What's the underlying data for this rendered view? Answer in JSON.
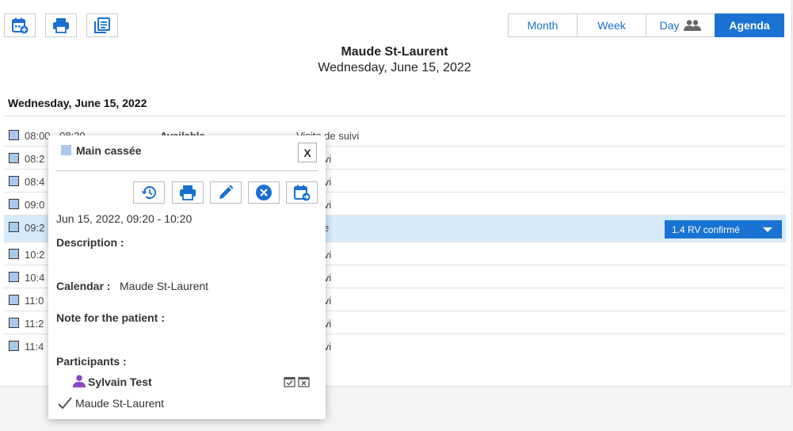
{
  "toolbar": {
    "new_icon": "calendar-plus-icon",
    "print_icon": "printer-icon",
    "list_icon": "list-icon"
  },
  "views": [
    {
      "label": "Month",
      "active": false
    },
    {
      "label": "Week",
      "active": false
    },
    {
      "label": "Day",
      "active": false,
      "icon": "people-icon"
    },
    {
      "label": "Agenda",
      "active": true
    }
  ],
  "header": {
    "name": "Maude St-Laurent",
    "date": "Wednesday, June 15, 2022"
  },
  "agenda": {
    "day_label": "Wednesday, June 15, 2022",
    "rows": [
      {
        "time": "08:00 - 08:20",
        "avail": "Available",
        "type": "Visite de suivi"
      },
      {
        "time": "08:2",
        "avail": "",
        "type": "de suivi"
      },
      {
        "time": "08:4",
        "avail": "",
        "type": "de suivi"
      },
      {
        "time": "09:0",
        "avail": "",
        "type": "de suivi"
      },
      {
        "time": "09:2",
        "avail": "",
        "type": "cassée"
      },
      {
        "time": "10:2",
        "avail": "",
        "type": "de suivi"
      },
      {
        "time": "10:4",
        "avail": "",
        "type": "de suivi"
      },
      {
        "time": "11:0",
        "avail": "",
        "type": "de suivi"
      },
      {
        "time": "11:2",
        "avail": "",
        "type": "de suivi"
      },
      {
        "time": "11:4",
        "avail": "",
        "type": "de suivi"
      }
    ],
    "selected_status": "1.4 RV confirmé"
  },
  "colors": {
    "accent": "#1a73d2",
    "event": "#a9c9ec",
    "selected_row": "#d6eafb",
    "person": "#8e44c9"
  },
  "popup": {
    "title": "Main cassée",
    "close_label": "X",
    "datetime": "Jun 15, 2022, 09:20 - 10:20",
    "description_label": "Description :",
    "calendar_label": "Calendar :",
    "calendar_value": "Maude St-Laurent",
    "note_label": "Note for the patient :",
    "participants_label": "Participants :",
    "participants": [
      {
        "name": "Sylvain Test",
        "icon": "person-icon"
      },
      {
        "name": "Maude St-Laurent",
        "icon": "check-icon"
      }
    ]
  }
}
